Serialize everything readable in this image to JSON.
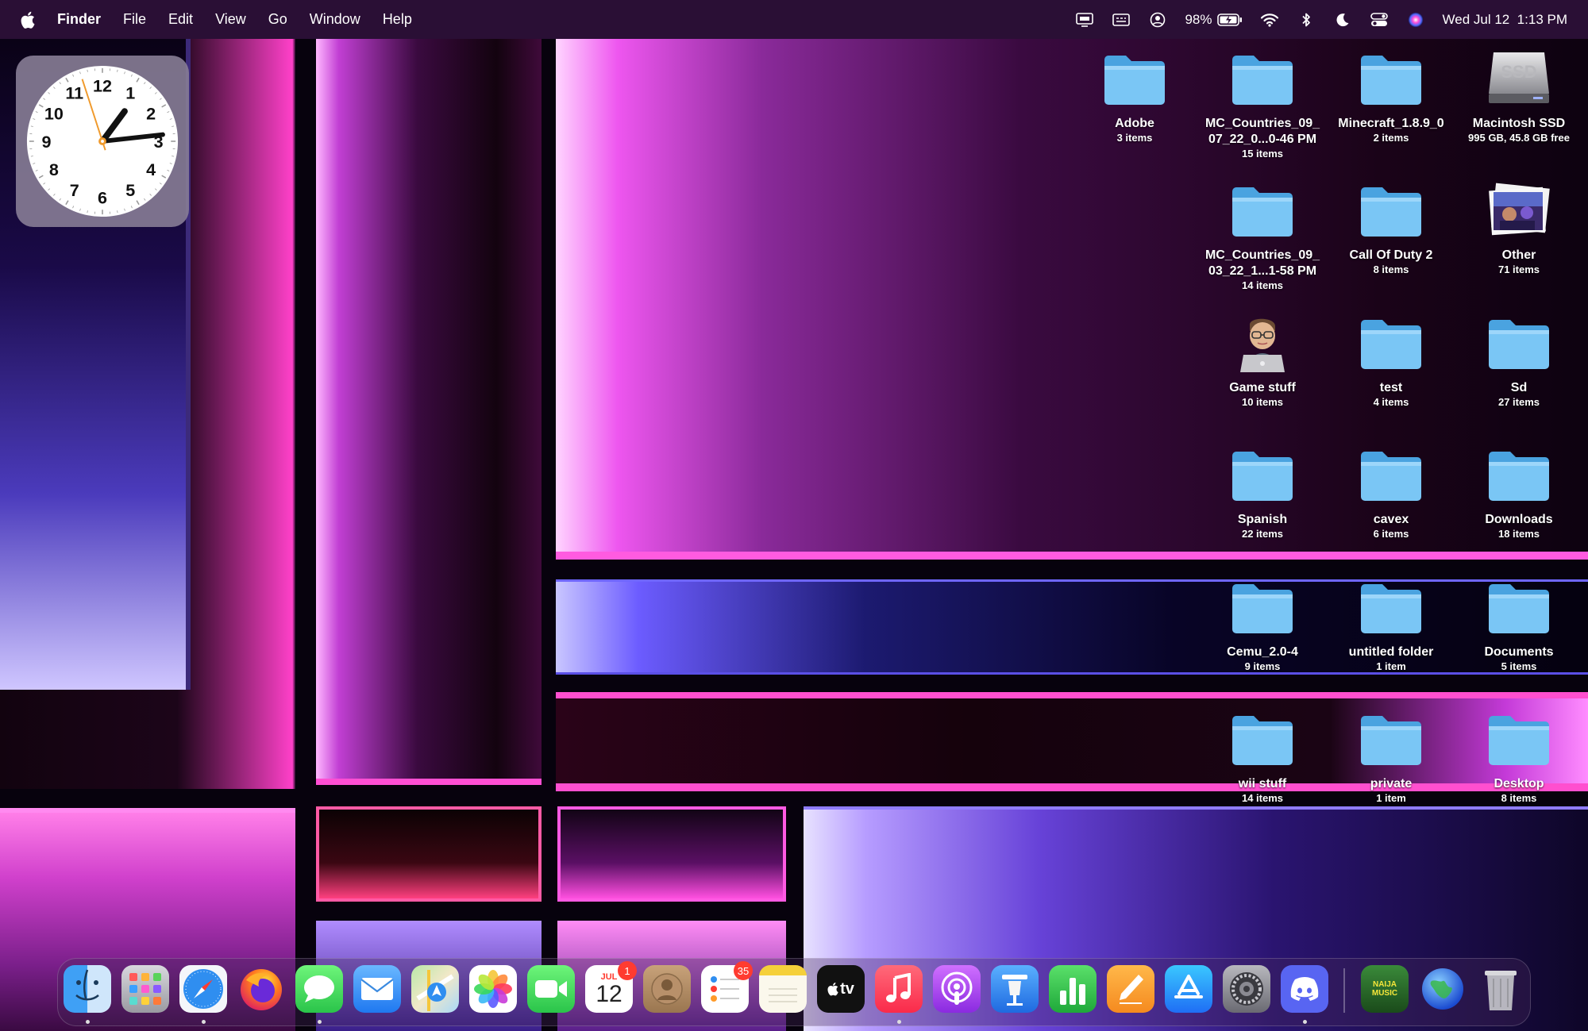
{
  "menubar": {
    "app_name": "Finder",
    "menus": [
      "File",
      "Edit",
      "View",
      "Go",
      "Window",
      "Help"
    ],
    "battery_percent": "98%",
    "datetime": "Wed Jul 12  1:13 PM"
  },
  "clock_widget": {
    "numbers": [
      "12",
      "1",
      "2",
      "3",
      "4",
      "5",
      "6",
      "7",
      "8",
      "9",
      "10",
      "11"
    ],
    "time": {
      "hour": 1,
      "minute": 13,
      "second": 57
    }
  },
  "desktop_icons": [
    {
      "label": "Adobe",
      "sub": "3 items"
    },
    {
      "label": "MC_Countries_09_\n07_22_0...0-46 PM",
      "sub": "15 items"
    },
    {
      "label": "Minecraft_1.8.9_0",
      "sub": "2 items"
    },
    {
      "label": "Macintosh SSD",
      "sub": "995 GB, 45.8 GB free"
    },
    {
      "label": "MC_Countries_09_\n03_22_1...1-58 PM",
      "sub": "14 items"
    },
    {
      "label": "Call Of Duty 2",
      "sub": "8 items"
    },
    {
      "label": "Other",
      "sub": "71 items"
    },
    {
      "label": "Game stuff",
      "sub": "10 items"
    },
    {
      "label": "test",
      "sub": "4 items"
    },
    {
      "label": "Sd",
      "sub": "27 items"
    },
    {
      "label": "Spanish",
      "sub": "22 items"
    },
    {
      "label": "cavex",
      "sub": "6 items"
    },
    {
      "label": "Downloads",
      "sub": "18 items"
    },
    {
      "label": "Cemu_2.0-4",
      "sub": "9 items"
    },
    {
      "label": "untitled folder",
      "sub": "1 item"
    },
    {
      "label": "Documents",
      "sub": "5 items"
    },
    {
      "label": "wii stuff",
      "sub": "14 items"
    },
    {
      "label": "private",
      "sub": "1 item"
    },
    {
      "label": "Desktop",
      "sub": "8 items"
    }
  ],
  "drive_label_text": "SSD",
  "dock": {
    "calendar_month": "JUL",
    "calendar_day": "12",
    "calendar_badge": "1",
    "reminders_badge": "35",
    "appletv_label": "tv",
    "music_art_text": "NAIJA MUSIC"
  }
}
